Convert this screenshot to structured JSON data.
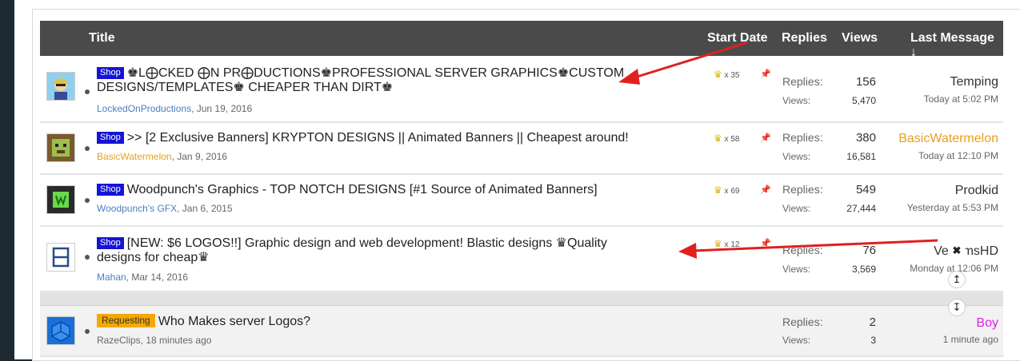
{
  "header": {
    "title": "Title",
    "start_date": "Start Date",
    "replies": "Replies",
    "views": "Views",
    "last_message": "Last Message ↓"
  },
  "threads": [
    {
      "prefix": "Shop",
      "title": "♚L⨁CKED ⨁N PR⨁DUCTIONS♚PROFESSIONAL SERVER GRAPHICS♚CUSTOM DESIGNS/TEMPLATES♚ CHEAPER THAN DIRT♚",
      "author": "LockedOnProductions",
      "date": ", Jun 19, 2016",
      "badge": "x 35",
      "replies_label": "Replies:",
      "replies": "156",
      "views_label": "Views:",
      "views": "5,470",
      "last_user": "Temping",
      "last_time": "Today at 5:02 PM"
    },
    {
      "prefix": "Shop",
      "title": ">> [2 Exclusive Banners] KRYPTON DESIGNS || Animated Banners || Cheapest around!",
      "author": "BasicWatermelon",
      "date": ", Jan 9, 2016",
      "badge": "x 58",
      "replies_label": "Replies:",
      "replies": "380",
      "views_label": "Views:",
      "views": "16,581",
      "last_user": "BasicWatermelon",
      "last_time": "Today at 12:10 PM"
    },
    {
      "prefix": "Shop",
      "title": "Woodpunch's Graphics - TOP NOTCH DESIGNS [#1 Source of Animated Banners]",
      "author": "Woodpunch's GFX",
      "date": ", Jan 6, 2015",
      "badge": "x 69",
      "replies_label": "Replies:",
      "replies": "549",
      "views_label": "Views:",
      "views": "27,444",
      "last_user": "Prodkid",
      "last_time": "Yesterday at 5:53 PM"
    },
    {
      "prefix": "Shop",
      "title": "[NEW: $6 LOGOS!!] Graphic design and web development! Blastic designs ♛Quality designs for cheap♛",
      "author": "Mahan",
      "date": ", Mar 14, 2016",
      "badge": "x 12",
      "replies_label": "Replies:",
      "replies": "76",
      "views_label": "Views:",
      "views": "3,569",
      "last_user": "VenomsHD",
      "last_time": "Monday at 12:06 PM"
    },
    {
      "prefix": "Requesting",
      "title": "Who Makes server Logos?",
      "author": "RazeClips",
      "date": ", 18 minutes ago",
      "replies_label": "Replies:",
      "replies": "2",
      "views_label": "Views:",
      "views": "3",
      "last_user": "Boy",
      "last_time": "1 minute ago"
    }
  ],
  "icons": {
    "badge": "trophy-icon",
    "pin": "pin-icon",
    "close": "close-icon",
    "scroll_up": "scroll-up-icon",
    "scroll_down": "scroll-down-icon"
  },
  "colors": {
    "header_bg": "#4a4a4a",
    "shop_prefix": "#1414d8",
    "requesting_prefix": "#f5a800",
    "annotation_arrow": "#e02020",
    "orange_user": "#e8a020",
    "pink_user": "#e020e0"
  }
}
